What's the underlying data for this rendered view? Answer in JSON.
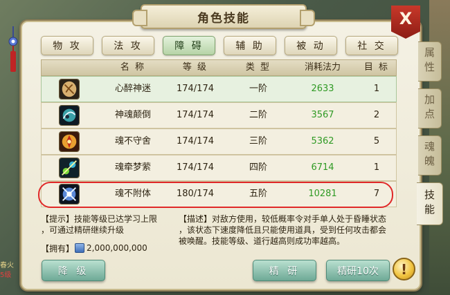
{
  "window": {
    "title": "角色技能",
    "close_label": "X"
  },
  "tabs": [
    {
      "label": "物 攻",
      "active": false
    },
    {
      "label": "法 攻",
      "active": false
    },
    {
      "label": "障 碍",
      "active": true
    },
    {
      "label": "辅 助",
      "active": false
    },
    {
      "label": "被 动",
      "active": false
    },
    {
      "label": "社 交",
      "active": false
    }
  ],
  "side_tabs": [
    {
      "label": "属性",
      "active": false
    },
    {
      "label": "加点",
      "active": false
    },
    {
      "label": "魂魄",
      "active": false
    },
    {
      "label": "技能",
      "active": true
    }
  ],
  "table": {
    "headers": [
      "名 称",
      "等 级",
      "类 型",
      "消耗法力",
      "目 标"
    ],
    "rows": [
      {
        "icon": "mind-charm-skill-icon",
        "name": "心醉神迷",
        "level": "174/174",
        "type": "一阶",
        "mana": "2633",
        "targets": "1",
        "selected": true
      },
      {
        "icon": "soul-daze-skill-icon",
        "name": "神魂颠倒",
        "level": "174/174",
        "type": "二阶",
        "mana": "3567",
        "targets": "2",
        "selected": false
      },
      {
        "icon": "soul-guard-skill-icon",
        "name": "魂不守舍",
        "level": "174/174",
        "type": "三阶",
        "mana": "5362",
        "targets": "5",
        "selected": false
      },
      {
        "icon": "soul-dream-skill-icon",
        "name": "魂牵梦萦",
        "level": "174/174",
        "type": "四阶",
        "mana": "6714",
        "targets": "1",
        "selected": false
      },
      {
        "icon": "soul-leave-skill-icon",
        "name": "魂不附体",
        "level": "180/174",
        "type": "五阶",
        "mana": "10281",
        "targets": "7",
        "selected": false
      }
    ]
  },
  "tip": {
    "line1": "【提示】技能等级已达学习上限",
    "line2": "，可通过精研继续升级"
  },
  "description": {
    "line1": "【描述】对敌方使用，较低概率令对手单人处于昏睡状态",
    "line2": "，该状态下速度降低且只能使用道具，受到任何攻击都会",
    "line3": "被唤醒。技能等级、道行越高则成功率越高。"
  },
  "owned": {
    "label": "【拥有】",
    "value": "2,000,000,000"
  },
  "buttons": {
    "downgrade": "降 级",
    "refine": "精 研",
    "refine10": "精研10次",
    "alert": "!"
  },
  "background_text": [
    "春火",
    "5级"
  ],
  "colors": {
    "mana": "#2f9a24",
    "highlight_oval": "#e02828",
    "active_tab": "#b6d3a6",
    "close": "#c8382a"
  }
}
